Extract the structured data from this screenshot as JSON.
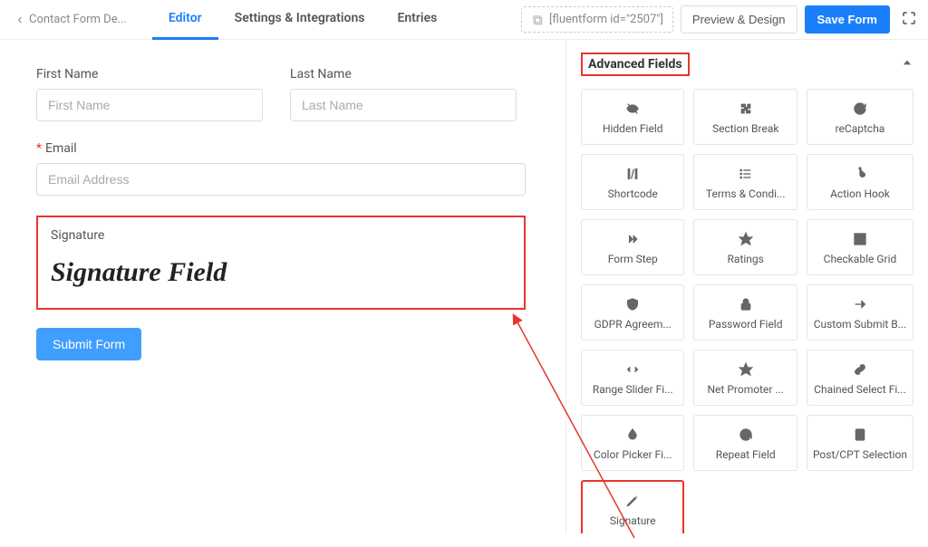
{
  "header": {
    "back_label": "Contact Form De...",
    "tabs": {
      "editor": "Editor",
      "settings": "Settings & Integrations",
      "entries": "Entries"
    },
    "shortcode": "[fluentform id=\"2507\"]",
    "preview_label": "Preview & Design",
    "save_label": "Save Form"
  },
  "form": {
    "first_name_label": "First Name",
    "first_name_placeholder": "First Name",
    "last_name_label": "Last Name",
    "last_name_placeholder": "Last Name",
    "email_label": "Email",
    "email_placeholder": "Email Address",
    "signature_label": "Signature",
    "signature_value": "Signature Field",
    "submit_label": "Submit Form"
  },
  "sidebar": {
    "section_title": "Advanced Fields",
    "cards": [
      "Hidden Field",
      "Section Break",
      "reCaptcha",
      "Shortcode",
      "Terms & Condi...",
      "Action Hook",
      "Form Step",
      "Ratings",
      "Checkable Grid",
      "GDPR Agreem...",
      "Password Field",
      "Custom Submit B...",
      "Range Slider Fi...",
      "Net Promoter ...",
      "Chained Select Fi...",
      "Color Picker Fi...",
      "Repeat Field",
      "Post/CPT Selection",
      "Signature"
    ]
  }
}
